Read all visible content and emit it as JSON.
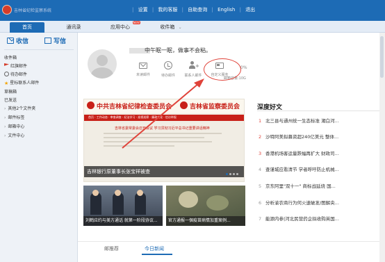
{
  "app": {
    "brand": "吉林省纪检监察系统"
  },
  "topnav": {
    "items": [
      "设置",
      "我的客服",
      "自助查询",
      "English",
      "退出"
    ]
  },
  "tabs": [
    {
      "label": "首页"
    },
    {
      "label": "通讯录"
    },
    {
      "label": "应用中心",
      "badge": "NEW"
    },
    {
      "label": "收件箱"
    }
  ],
  "compose": {
    "receive": "收信",
    "write": "写信"
  },
  "folders": [
    {
      "label": "收件箱"
    },
    {
      "label": "红旗邮件"
    },
    {
      "label": "待办邮件"
    },
    {
      "label": "星标联系人邮件"
    },
    {
      "label": "草稿箱"
    },
    {
      "label": "已发送"
    },
    {
      "label": "其他2个文件夹"
    },
    {
      "label": "邮件标签"
    },
    {
      "label": "邮箱中心"
    },
    {
      "label": "文件中心"
    }
  ],
  "profile": {
    "greeting": "中午眠一眠，做事不会粘。",
    "stats": [
      {
        "label": "未读邮件",
        "icon": "mail-icon"
      },
      {
        "label": "待办邮件",
        "icon": "clock-icon"
      },
      {
        "label": "联系人邮件",
        "icon": "contact-icon"
      },
      {
        "label": "自定义服务",
        "icon": "card-icon"
      }
    ],
    "storage_percent": "0%",
    "storage_label": "邮箱容量:10G"
  },
  "banner": {
    "title_left": "中共吉林省纪律检查委员会",
    "title_right": "吉林省监察委员会",
    "nav_text": "首页 · 工作动态 · 审查调查 · 纪法学习 · 巡视巡察 · 廉政文化 · 信访举报",
    "headline": "吉林省委常委会召开会议 学习贯彻习近平总书记重要讲话精神",
    "caption": "吉林银行原董事长张宝祥被查"
  },
  "thumbs": [
    {
      "caption": "刘鹤应约与美方通话 就第一阶段协议..."
    },
    {
      "caption": "官方通报一個疫苗病情加重案例..."
    }
  ],
  "deep": {
    "title": "深度好文",
    "items": [
      {
        "num": "1",
        "text": "北三县与通州统一生态标准 潮白河..."
      },
      {
        "num": "2",
        "text": "沙特阿美拟募资超240亿美元 整体..."
      },
      {
        "num": "3",
        "text": "香港机场客运量跌幅再扩大 财政司..."
      },
      {
        "num": "4",
        "text": "查谨城应看清节 学者呼吁防止机械..."
      },
      {
        "num": "5",
        "text": "京东阿里\"双十一\" 商标战延烧 国..."
      },
      {
        "num": "6",
        "text": "分析渝农商行为何火速破发/图解央..."
      },
      {
        "num": "7",
        "text": "能源内参|河北民营药企拟收购英国..."
      }
    ]
  },
  "bottom_tabs": {
    "recommend": "邮推荐",
    "today": "今日新闻"
  },
  "colors": {
    "primary": "#1d6bb5",
    "accent": "#e0433a",
    "party_red": "#c82018"
  }
}
